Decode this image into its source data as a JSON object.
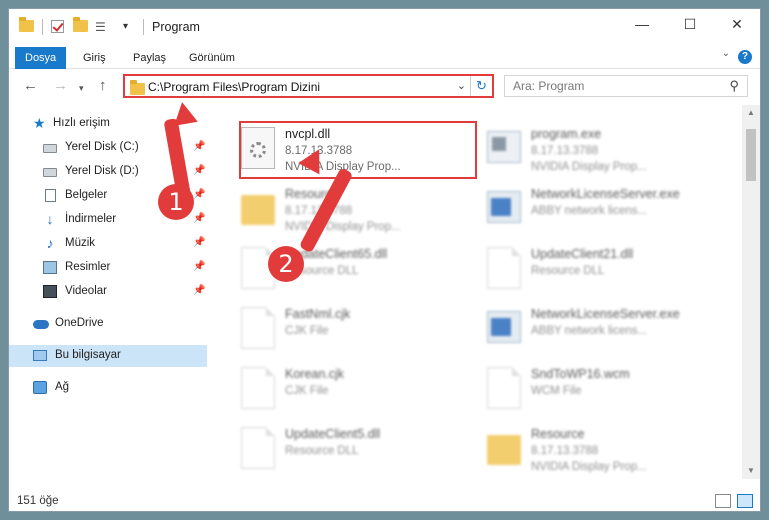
{
  "window": {
    "title": "Program",
    "controls": {
      "minimize": "—",
      "maximize": "☐",
      "close": "✕"
    }
  },
  "ribbon": {
    "tabs": [
      "Dosya",
      "Giriş",
      "Paylaş",
      "Görünüm"
    ],
    "help": "?"
  },
  "address": {
    "path": "C:\\Program Files\\Program Dizini",
    "search_placeholder": "Ara: Program"
  },
  "sidebar": {
    "items": [
      {
        "label": "Hızlı erişim",
        "icon": "star-icon"
      },
      {
        "label": "Yerel Disk (C:)",
        "icon": "disk-icon"
      },
      {
        "label": "Yerel Disk (D:)",
        "icon": "disk-icon"
      },
      {
        "label": "Belgeler",
        "icon": "document-icon"
      },
      {
        "label": "İndirmeler",
        "icon": "download-icon"
      },
      {
        "label": "Müzik",
        "icon": "music-icon"
      },
      {
        "label": "Resimler",
        "icon": "pictures-icon"
      },
      {
        "label": "Videolar",
        "icon": "videos-icon"
      },
      {
        "label": "OneDrive",
        "icon": "onedrive-icon"
      },
      {
        "label": "Bu bilgisayar",
        "icon": "computer-icon"
      },
      {
        "label": "Ağ",
        "icon": "network-icon"
      }
    ]
  },
  "files": [
    {
      "name": "nvcpl.dll",
      "line2": "8.17.13.3788",
      "line3": "NVIDIA Display Prop...",
      "icon": "dll-icon"
    },
    {
      "name": "program.exe",
      "line2": "8.17.13.3788",
      "line3": "NVIDIA Display Prop...",
      "icon": "exe-icon"
    },
    {
      "name": "Resource",
      "line2": "8.17.13.3788",
      "line3": "NVIDIA Display Prop...",
      "icon": "folder-icon"
    },
    {
      "name": "NetworkLicenseServer.exe",
      "line2": "ABBY network licens...",
      "line3": "",
      "icon": "exe-icon"
    },
    {
      "name": "UpdateClient65.dll",
      "line2": "Resource DLL",
      "line3": "",
      "icon": "file-icon"
    },
    {
      "name": "UpdateClient21.dll",
      "line2": "Resource DLL",
      "line3": "",
      "icon": "file-icon"
    },
    {
      "name": "FastNml.cjk",
      "line2": "CJK File",
      "line3": "",
      "icon": "file-icon"
    },
    {
      "name": "NetworkLicenseServer.exe",
      "line2": "ABBY network licens...",
      "line3": "",
      "icon": "exe-icon"
    },
    {
      "name": "Korean.cjk",
      "line2": "CJK File",
      "line3": "",
      "icon": "file-icon"
    },
    {
      "name": "SndToWP16.wcm",
      "line2": "WCM File",
      "line3": "",
      "icon": "file-icon"
    },
    {
      "name": "UpdateClient5.dll",
      "line2": "Resource DLL",
      "line3": "",
      "icon": "file-icon"
    },
    {
      "name": "Resource",
      "line2": "8.17.13.3788",
      "line3": "NVIDIA Display Prop...",
      "icon": "folder-icon"
    }
  ],
  "status": {
    "count": "151 öğe"
  },
  "annotations": {
    "step1": "1",
    "step2": "2"
  },
  "colors": {
    "accent": "#1979ca",
    "highlight": "#e23b3b",
    "selected": "#cce4f7"
  }
}
